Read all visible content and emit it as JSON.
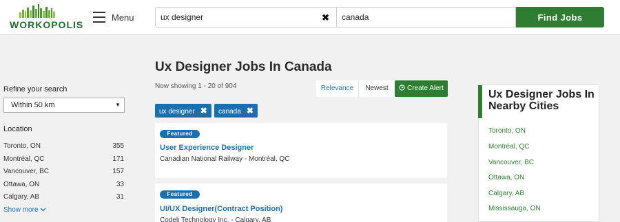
{
  "header": {
    "logo_text": "WORKOPOLIS",
    "menu_label": "Menu",
    "search_what": "ux designer",
    "search_where": "canada",
    "find_button": "Find Jobs"
  },
  "sidebar": {
    "refine_label": "Refine your search",
    "distance_selected": "Within 50 km",
    "location_title": "Location",
    "locations": [
      {
        "name": "Toronto, ON",
        "count": "355"
      },
      {
        "name": "Montréal, QC",
        "count": "171"
      },
      {
        "name": "Vancouver, BC",
        "count": "157"
      },
      {
        "name": "Ottawa, ON",
        "count": "33"
      },
      {
        "name": "Calgary, AB",
        "count": "31"
      }
    ],
    "show_more": "Show more"
  },
  "main": {
    "title": "Ux Designer Jobs In Canada",
    "showing": "Now showing 1 - 20 of 904",
    "sort_relevance": "Relevance",
    "sort_newest": "Newest",
    "create_alert": "Create Alert",
    "filters": [
      "ux designer",
      "canada"
    ],
    "jobs": [
      {
        "badge": "Featured",
        "title": "User Experience Designer",
        "company": "Canadian National Railway - Montréal, QC"
      },
      {
        "badge": "Featured",
        "title": "UI/UX Designer(Contract Position)",
        "company": "Codeli Technology Inc. - Calgary, AB"
      }
    ]
  },
  "nearby": {
    "title": "Ux Designer Jobs In Nearby Cities",
    "cities": [
      "Toronto, ON",
      "Montréal, QC",
      "Vancouver, BC",
      "Ottawa, ON",
      "Calgary, AB",
      "Mississauga, ON"
    ]
  },
  "colors": {
    "brand_green": "#2f7d32",
    "link_blue": "#1a6fb0"
  },
  "icons": {
    "clear": "close-icon",
    "menu": "hamburger-icon",
    "alert": "clock-icon",
    "show_more": "chevron-down-icon"
  }
}
